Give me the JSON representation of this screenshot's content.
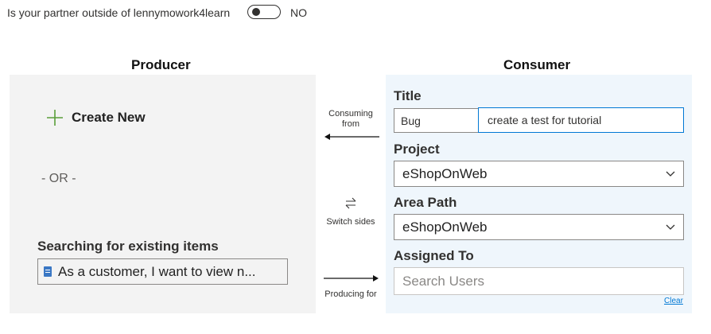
{
  "toggle_row": {
    "question": "Is your partner outside of lennymowork4learn",
    "toggle_state": "NO"
  },
  "producer": {
    "heading": "Producer",
    "create_new": "Create New",
    "or_text": "- OR -",
    "search_heading": "Searching for existing items",
    "existing_item": "As a customer, I want to view n..."
  },
  "middle": {
    "consuming_from": "Consuming from",
    "switch_sides": "Switch sides",
    "producing_for": "Producing for"
  },
  "consumer": {
    "heading": "Consumer",
    "title_label": "Title",
    "work_item_type": "Bug",
    "title_value": "create a test for tutorial",
    "project_label": "Project",
    "project_value": "eShopOnWeb",
    "area_path_label": "Area Path",
    "area_path_value": "eShopOnWeb",
    "assigned_to_label": "Assigned To",
    "search_users_placeholder": "Search Users",
    "clear_link": "Clear"
  },
  "icons": {
    "create_new": "plus-icon",
    "existing_item": "work-item-icon",
    "dropdowns": "chevron-down-icon",
    "switch": "swap-arrows-icon",
    "consuming_arrow": "arrow-left-icon",
    "producing_arrow": "arrow-right-icon"
  },
  "colors": {
    "producer_panel": "#f3f3f3",
    "consumer_panel": "#eff6fc",
    "plus_icon": "#5a9e3a",
    "work_item_icon": "#3a77c4",
    "accent": "#0078d4"
  }
}
